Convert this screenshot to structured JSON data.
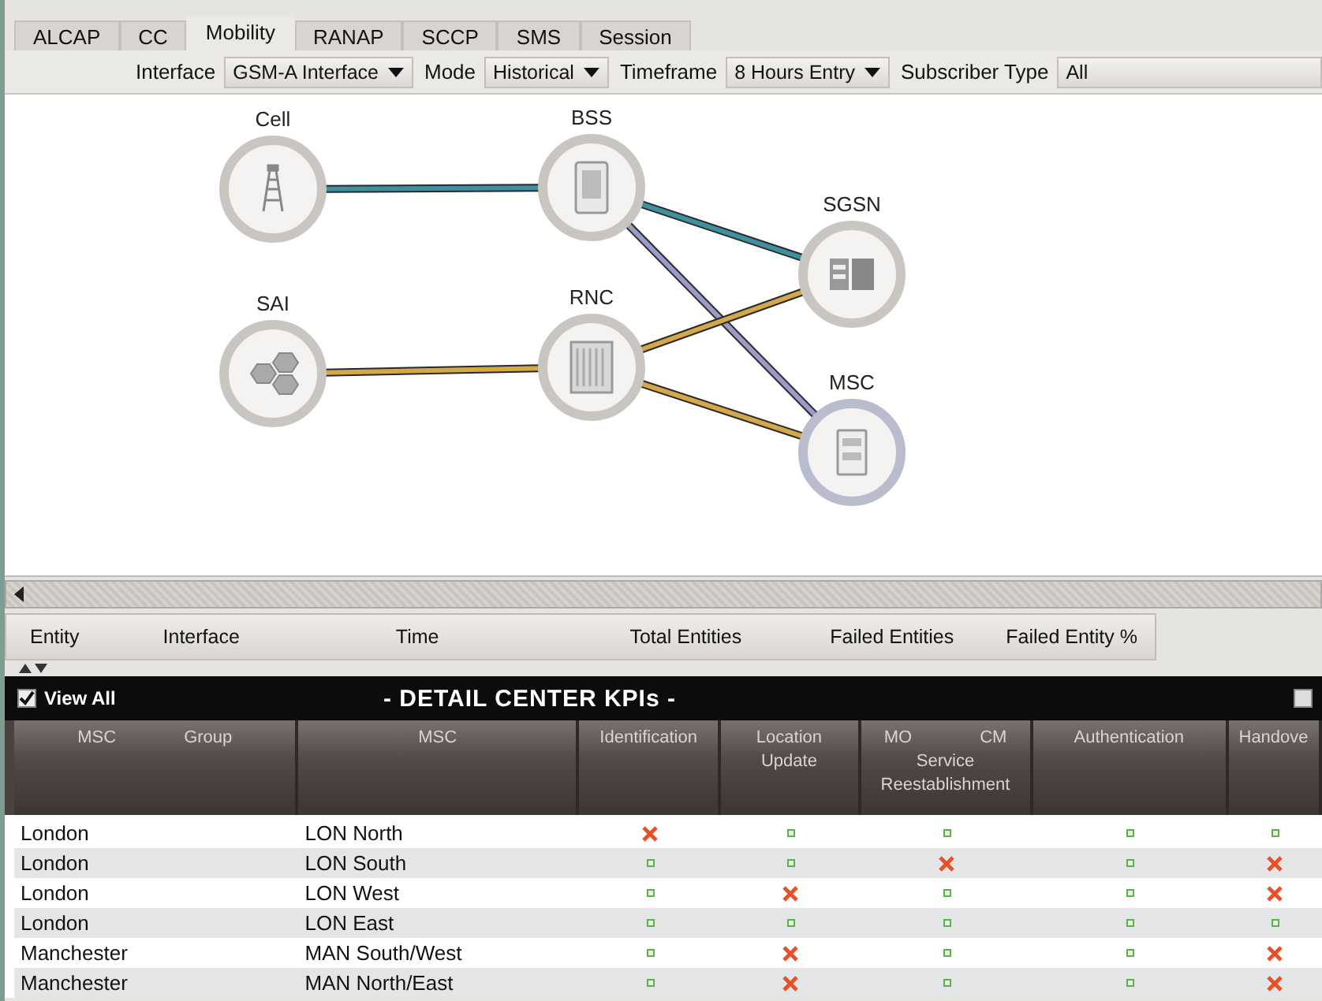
{
  "tabs": [
    {
      "label": "ALCAP",
      "selected": false
    },
    {
      "label": "CC",
      "selected": false
    },
    {
      "label": "Mobility",
      "selected": true
    },
    {
      "label": "RANAP",
      "selected": false
    },
    {
      "label": "SCCP",
      "selected": false
    },
    {
      "label": "SMS",
      "selected": false
    },
    {
      "label": "Session",
      "selected": false
    }
  ],
  "filters": [
    {
      "label": "Interface",
      "value": "GSM-A Interface",
      "kind": "dropdown"
    },
    {
      "label": "Mode",
      "value": "Historical",
      "kind": "dropdown"
    },
    {
      "label": "Timeframe",
      "value": "8 Hours Entry",
      "kind": "dropdown"
    },
    {
      "label": "Subscriber Type",
      "value": "All",
      "kind": "field"
    }
  ],
  "diagram": {
    "nodes": [
      {
        "name": "Cell",
        "kind": "tower"
      },
      {
        "name": "BSS",
        "kind": "server"
      },
      {
        "name": "SGSN",
        "kind": "dual"
      },
      {
        "name": "SAI",
        "kind": "hex"
      },
      {
        "name": "RNC",
        "kind": "rack"
      },
      {
        "name": "MSC",
        "kind": "cabinet"
      }
    ],
    "links": [
      {
        "color": "#3f8fa0"
      },
      {
        "color": "#3f8fa0"
      },
      {
        "color": "#9a9cc8"
      },
      {
        "color": "#d4a84a"
      },
      {
        "color": "#d4a84a"
      },
      {
        "color": "#d4a84a"
      }
    ]
  },
  "summary_columns": [
    "Entity",
    "Interface",
    "Time",
    "Total Entities",
    "Failed Entities",
    "Failed Entity %"
  ],
  "kpi_panel": {
    "view_all": {
      "label": "View All",
      "checked": true
    },
    "title": "- DETAIL CENTER KPIs -",
    "side_checkbox": {
      "checked": false
    },
    "columns": [
      "MSC Group",
      "MSC",
      "Identification",
      "Location Update",
      "MO CM Service Reestablishment",
      "Authentication",
      "Handove"
    ],
    "rows": [
      {
        "group": "London",
        "msc": "LON North",
        "status": [
          {
            "failed": true
          },
          {
            "failed": false
          },
          {
            "failed": false
          },
          {
            "failed": false
          },
          {
            "failed": false
          }
        ]
      },
      {
        "group": "London",
        "msc": "LON South",
        "status": [
          {
            "failed": false
          },
          {
            "failed": false
          },
          {
            "failed": true
          },
          {
            "failed": false
          },
          {
            "failed": true
          }
        ]
      },
      {
        "group": "London",
        "msc": "LON West",
        "status": [
          {
            "failed": false
          },
          {
            "failed": true
          },
          {
            "failed": false
          },
          {
            "failed": false
          },
          {
            "failed": true
          }
        ]
      },
      {
        "group": "London",
        "msc": "LON East",
        "status": [
          {
            "failed": false
          },
          {
            "failed": false
          },
          {
            "failed": false
          },
          {
            "failed": false
          },
          {
            "failed": false
          }
        ]
      },
      {
        "group": "Manchester",
        "msc": "MAN South/West",
        "status": [
          {
            "failed": false
          },
          {
            "failed": true
          },
          {
            "failed": false
          },
          {
            "failed": false
          },
          {
            "failed": true
          }
        ]
      },
      {
        "group": "Manchester",
        "msc": "MAN North/East",
        "status": [
          {
            "failed": false
          },
          {
            "failed": true
          },
          {
            "failed": false
          },
          {
            "failed": false
          },
          {
            "failed": true
          }
        ]
      }
    ]
  }
}
